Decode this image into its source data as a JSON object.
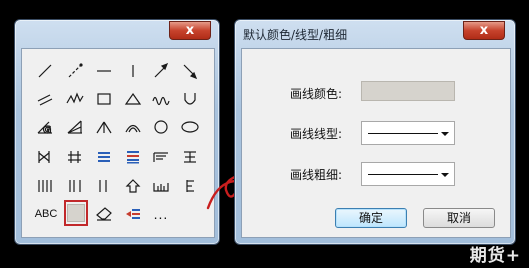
{
  "palette_window": {
    "close_glyph": "x",
    "text_tool_label": "ABC",
    "more_tools_label": "...",
    "tools": [
      "line-icon",
      "dashed-line-icon",
      "horizontal-line-icon",
      "vertical-line-icon",
      "arrow-line-icon",
      "ray-icon",
      "parallel-lines-icon",
      "zigzag-icon",
      "rectangle-icon",
      "triangle-icon",
      "wave-icon",
      "u-curve-icon",
      "gann-angle-icon",
      "gann-fan-icon",
      "fan-lines-icon",
      "arc-icon",
      "circle-icon",
      "ellipse-icon",
      "channel-icon",
      "pitchfork-icon",
      "fibonacci-retracement-icon",
      "fibonacci-levels-icon",
      "speed-lines-icon",
      "cycle-lines-icon",
      "vertical-cycles-icon",
      "time-zones-icon",
      "blue-time-lines-icon",
      "up-arrow-icon",
      "candle-marks-icon",
      "ruler-icon"
    ],
    "selected_tool": "line-style-settings-icon",
    "bottom_tools": [
      "text-tool-icon",
      "line-style-settings-icon",
      "eraser-icon",
      "price-labels-icon",
      "more-tools-icon"
    ]
  },
  "settings_dialog": {
    "title": "默认颜色/线型/粗细",
    "close_glyph": "x",
    "color_label": "画线颜色:",
    "color_value": "#d6d3cd",
    "line_type_label": "画线线型:",
    "line_width_label": "画线粗细:",
    "ok_button": "确定",
    "cancel_button": "取消"
  },
  "annotation": {
    "arrow_color": "#c81e1e"
  },
  "watermark": "期货+"
}
